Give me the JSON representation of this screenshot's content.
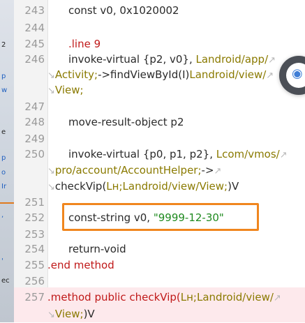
{
  "background_app": {
    "fragments": [
      "2",
      "p",
      "w",
      "e",
      "p",
      "o",
      "Ir",
      ",",
      "'",
      "ec"
    ]
  },
  "lines": [
    {
      "n": "243",
      "code": [
        {
          "t": "const v0, 0x1020002",
          "c": "plain"
        }
      ]
    },
    {
      "n": "244",
      "code": []
    },
    {
      "n": "245",
      "code": [
        {
          "t": ".line 9",
          "c": "red"
        }
      ]
    },
    {
      "n": "246",
      "code": [
        {
          "t": "invoke-virtual {p2, v0}, ",
          "c": "plain"
        },
        {
          "t": "Landroid/app/",
          "c": "type"
        },
        {
          "t": "↗",
          "c": "wrap"
        }
      ]
    },
    {
      "n": "",
      "code": [
        {
          "t": "↘",
          "c": "wrap"
        },
        {
          "t": "Activity;",
          "c": "type"
        },
        {
          "t": "->findViewById(I)",
          "c": "plain"
        },
        {
          "t": "Landroid/view/",
          "c": "type"
        },
        {
          "t": "↗",
          "c": "wrap"
        }
      ]
    },
    {
      "n": "",
      "code": [
        {
          "t": "↘",
          "c": "wrap"
        },
        {
          "t": "View;",
          "c": "type"
        }
      ]
    },
    {
      "n": "247",
      "code": []
    },
    {
      "n": "248",
      "code": [
        {
          "t": "move-result-object p2",
          "c": "plain"
        }
      ]
    },
    {
      "n": "249",
      "code": []
    },
    {
      "n": "250",
      "code": [
        {
          "t": "invoke-virtual {p0, p1, p2}, ",
          "c": "plain"
        },
        {
          "t": "Lcom/vmos/",
          "c": "type"
        },
        {
          "t": "↗",
          "c": "wrap"
        }
      ]
    },
    {
      "n": "",
      "code": [
        {
          "t": "↘",
          "c": "wrap"
        },
        {
          "t": "pro/account/AccountHelper;",
          "c": "type"
        },
        {
          "t": "->",
          "c": "plain"
        },
        {
          "t": "↗",
          "c": "wrap"
        }
      ]
    },
    {
      "n": "",
      "code": [
        {
          "t": "↘",
          "c": "wrap"
        },
        {
          "t": "checkVip(",
          "c": "plain"
        },
        {
          "t": "Lн;Landroid/view/View;",
          "c": "type"
        },
        {
          "t": ")V",
          "c": "plain"
        }
      ]
    },
    {
      "n": "251",
      "code": []
    },
    {
      "n": "252",
      "code": [
        {
          "t": "const-string v0, ",
          "c": "plain"
        },
        {
          "t": "\"9999-12-30\"",
          "c": "str"
        }
      ]
    },
    {
      "n": "253",
      "code": []
    },
    {
      "n": "254",
      "code": [
        {
          "t": "return-void",
          "c": "plain"
        }
      ]
    },
    {
      "n": "255",
      "code": [
        {
          "t": ".end method",
          "c": "red"
        }
      ]
    },
    {
      "n": "256",
      "code": []
    },
    {
      "n": "257",
      "code": [
        {
          "t": ".method public checkVip(",
          "c": "red"
        },
        {
          "t": "Lн;Landroid/view/",
          "c": "type"
        },
        {
          "t": "↗",
          "c": "wrap"
        }
      ]
    },
    {
      "n": "",
      "code": [
        {
          "t": "↘",
          "c": "wrap"
        },
        {
          "t": "View;",
          "c": "type"
        },
        {
          "t": ")V",
          "c": "plain"
        }
      ]
    }
  ],
  "colors": {
    "gutter_bg": "#f3f3f3",
    "line_number": "#9a9a9a",
    "plain": "#2a2a2a",
    "type": "#8a7a00",
    "string": "#1f8a1f",
    "red": "#c01919",
    "wrap": "#b8b8b8",
    "selection": "#f0861e",
    "method_highlight": "#fde9ec"
  },
  "floating": {
    "icon": "app-icon"
  }
}
